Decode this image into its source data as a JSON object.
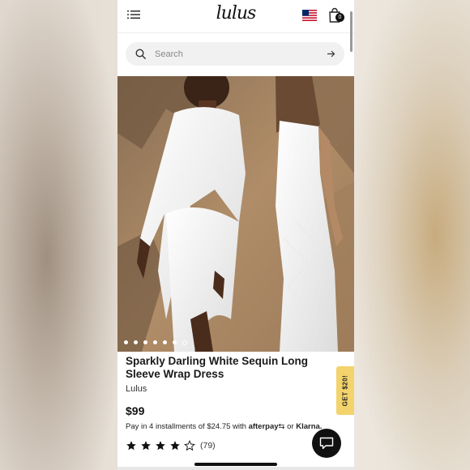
{
  "header": {
    "logo_text": "lulus",
    "bag_count": "0",
    "icons": [
      "menu-icon",
      "us-flag-icon",
      "shopping-bag-icon"
    ]
  },
  "search": {
    "placeholder": "Search",
    "icons": [
      "search-icon",
      "arrow-right-icon"
    ]
  },
  "carousel": {
    "total_slides": 7,
    "active_slide": 6
  },
  "product": {
    "title": "Sparkly Darling White Sequin Long Sleeve Wrap Dress",
    "brand": "Lulus",
    "price": "$99",
    "installments_prefix": "Pay in 4 installments of $24.75 with",
    "afterpay_label": "afterpay",
    "or_label": "or",
    "klarna_label": "Klarna.",
    "rating": 4,
    "rating_max": 5,
    "review_count": "(79)"
  },
  "promo_tab": {
    "label": "GET $20!",
    "color": "#f3d36b"
  },
  "chat": {
    "icon": "chat-bubble-icon"
  },
  "colors": {
    "text": "#1a1a1a",
    "chat_bg": "#111111"
  }
}
